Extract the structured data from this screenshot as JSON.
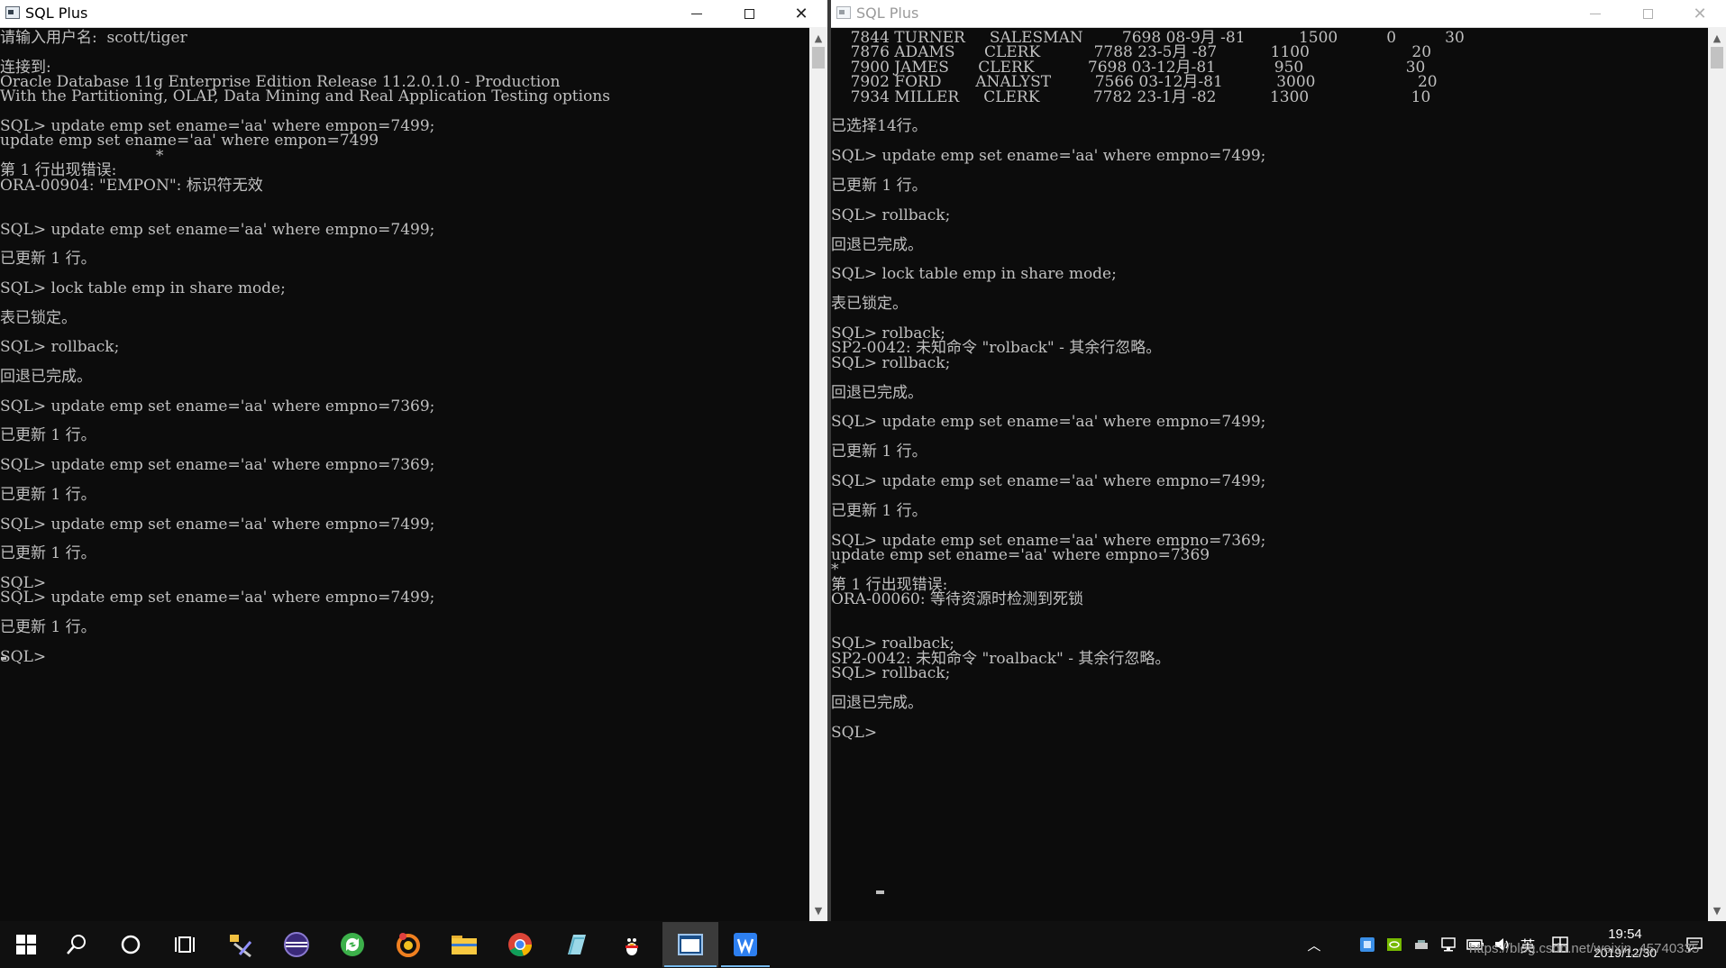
{
  "colors": {
    "console_bg": "#0c0c0c",
    "console_text": "#c0c0c0",
    "taskbar_bg": "#101010",
    "active_app_highlight": "#3b3b3b",
    "active_underline": "#76b9ed"
  },
  "left_window": {
    "title": "SQL Plus",
    "icon": "sqlplus-console-icon",
    "controls": [
      "minimize",
      "maximize",
      "close"
    ],
    "lines": [
      "请输入用户名:  scott/tiger",
      "",
      "连接到:",
      "Oracle Database 11g Enterprise Edition Release 11.2.0.1.0 - Production",
      "With the Partitioning, OLAP, Data Mining and Real Application Testing options",
      "",
      "SQL> update emp set ename='aa' where empon=7499;",
      "update emp set ename='aa' where empon=7499",
      "                                *",
      "第 1 行出现错误:",
      "ORA-00904: \"EMPON\": 标识符无效",
      "",
      "",
      "SQL> update emp set ename='aa' where empno=7499;",
      "",
      "已更新 1 行。",
      "",
      "SQL> lock table emp in share mode;",
      "",
      "表已锁定。",
      "",
      "SQL> rollback;",
      "",
      "回退已完成。",
      "",
      "SQL> update emp set ename='aa' where empno=7369;",
      "",
      "已更新 1 行。",
      "",
      "SQL> update emp set ename='aa' where empno=7369;",
      "",
      "已更新 1 行。",
      "",
      "SQL> update emp set ename='aa' where empno=7499;",
      "",
      "已更新 1 行。",
      "",
      "SQL>",
      "SQL> update emp set ename='aa' where empno=7499;",
      "",
      "已更新 1 行。",
      "",
      "SQL>"
    ]
  },
  "right_window": {
    "title": "SQL Plus",
    "icon": "sqlplus-console-icon",
    "controls": [
      "minimize",
      "maximize",
      "close"
    ],
    "lines": [
      "    7844 TURNER     SALESMAN        7698 08-9月 -81           1500          0          30",
      "    7876 ADAMS      CLERK           7788 23-5月 -87           1100                     20",
      "    7900 JAMES      CLERK           7698 03-12月-81            950                     30",
      "    7902 FORD       ANALYST         7566 03-12月-81           3000                     20",
      "    7934 MILLER     CLERK           7782 23-1月 -82           1300                     10",
      "",
      "已选择14行。",
      "",
      "SQL> update emp set ename='aa' where empno=7499;",
      "",
      "已更新 1 行。",
      "",
      "SQL> rollback;",
      "",
      "回退已完成。",
      "",
      "SQL> lock table emp in share mode;",
      "",
      "表已锁定。",
      "",
      "SQL> rolback;",
      "SP2-0042: 未知命令 \"rolback\" - 其余行忽略。",
      "SQL> rollback;",
      "",
      "回退已完成。",
      "",
      "SQL> update emp set ename='aa' where empno=7499;",
      "",
      "已更新 1 行。",
      "",
      "SQL> update emp set ename='aa' where empno=7499;",
      "",
      "已更新 1 行。",
      "",
      "SQL> update emp set ename='aa' where empno=7369;",
      "update emp set ename='aa' where empno=7369",
      "*",
      "第 1 行出现错误:",
      "ORA-00060: 等待资源时检测到死锁",
      "",
      "",
      "SQL> roalback;",
      "SP2-0042: 未知命令 \"roalback\" - 其余行忽略。",
      "SQL> rollback;",
      "",
      "回退已完成。",
      "",
      "SQL> "
    ]
  },
  "taskbar": {
    "apps": [
      {
        "name": "start-windows-icon",
        "active": false
      },
      {
        "name": "search-icon",
        "active": false
      },
      {
        "name": "cortana-icon",
        "active": false
      },
      {
        "name": "task-view-icon",
        "active": false
      },
      {
        "name": "tools-app-icon",
        "active": false
      },
      {
        "name": "eclipse-icon",
        "active": false
      },
      {
        "name": "sync-app-icon",
        "active": false
      },
      {
        "name": "browser-app-icon",
        "active": false
      },
      {
        "name": "file-explorer-icon",
        "active": false
      },
      {
        "name": "chrome-icon",
        "active": false
      },
      {
        "name": "notes-app-icon",
        "active": false
      },
      {
        "name": "qq-penguin-icon",
        "active": false
      },
      {
        "name": "sqlplus-app-icon",
        "active": true
      },
      {
        "name": "wps-writer-icon",
        "active": false
      }
    ],
    "tray": {
      "ime_label": "英",
      "time": "19:54",
      "date": "2019/12/30"
    },
    "watermark": "https://blog.csdn.net/weixin_45740335"
  }
}
